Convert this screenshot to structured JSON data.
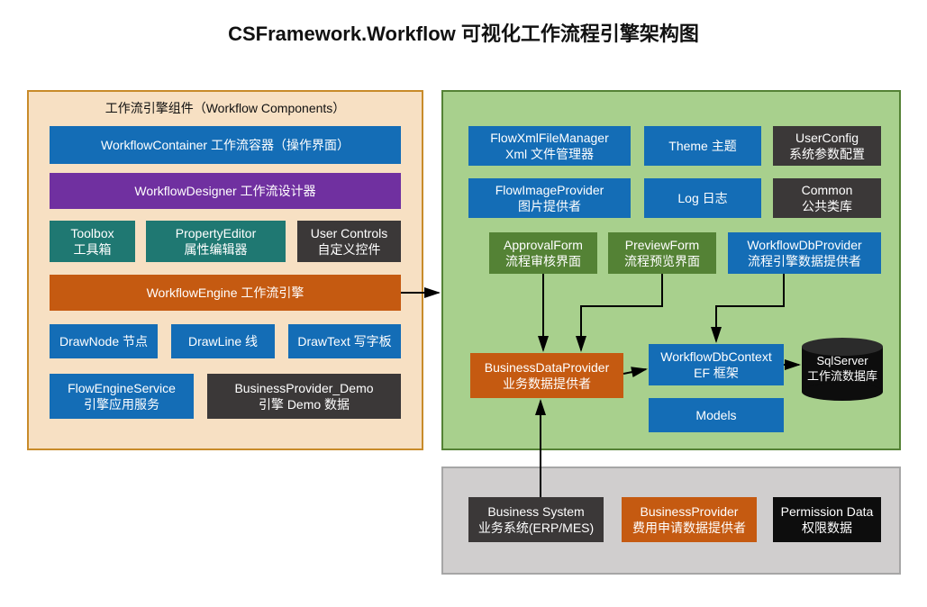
{
  "title": "CSFramework.Workflow 可视化工作流程引擎架构图",
  "left": {
    "header": "工作流引擎组件（Workflow Components）",
    "container": "WorkflowContainer 工作流容器（操作界面）",
    "designer": "WorkflowDesigner 工作流设计器",
    "toolbox": {
      "l1": "Toolbox",
      "l2": "工具箱"
    },
    "propeditor": {
      "l1": "PropertyEditor",
      "l2": "属性编辑器"
    },
    "usercontrols": {
      "l1": "User Controls",
      "l2": "自定义控件"
    },
    "engine": "WorkflowEngine 工作流引擎",
    "drawnode": "DrawNode 节点",
    "drawline": "DrawLine 线",
    "drawtext": "DrawText 写字板",
    "flowenginesvc": {
      "l1": "FlowEngineService",
      "l2": "引擎应用服务"
    },
    "bizprovdemo": {
      "l1": "BusinessProvider_Demo",
      "l2": "引擎 Demo 数据"
    }
  },
  "right": {
    "flowxml": {
      "l1": "FlowXmlFileManager",
      "l2": "Xml 文件管理器"
    },
    "theme": "Theme  主题",
    "userconfig": {
      "l1": "UserConfig",
      "l2": "系统参数配置"
    },
    "flowimg": {
      "l1": "FlowImageProvider",
      "l2": "图片提供者"
    },
    "log": "Log  日志",
    "common": {
      "l1": "Common",
      "l2": "公共类库"
    },
    "approval": {
      "l1": "ApprovalForm",
      "l2": "流程审核界面"
    },
    "preview": {
      "l1": "PreviewForm",
      "l2": "流程预览界面"
    },
    "wfdbprov": {
      "l1": "WorkflowDbProvider",
      "l2": "流程引擎数据提供者"
    },
    "bizdataprov": {
      "l1": "BusinessDataProvider",
      "l2": "业务数据提供者"
    },
    "wfdbctx": {
      "l1": "WorkflowDbContext",
      "l2": "EF 框架"
    },
    "models": "Models",
    "sqlserver": {
      "l1": "SqlServer",
      "l2": "工作流数据库"
    }
  },
  "bottom": {
    "bizsys": {
      "l1": "Business System",
      "l2": "业务系统(ERP/MES)"
    },
    "bizprov": {
      "l1": "BusinessProvider",
      "l2": "费用申请数据提供者"
    },
    "permdata": {
      "l1": "Permission Data",
      "l2": "权限数据"
    }
  }
}
